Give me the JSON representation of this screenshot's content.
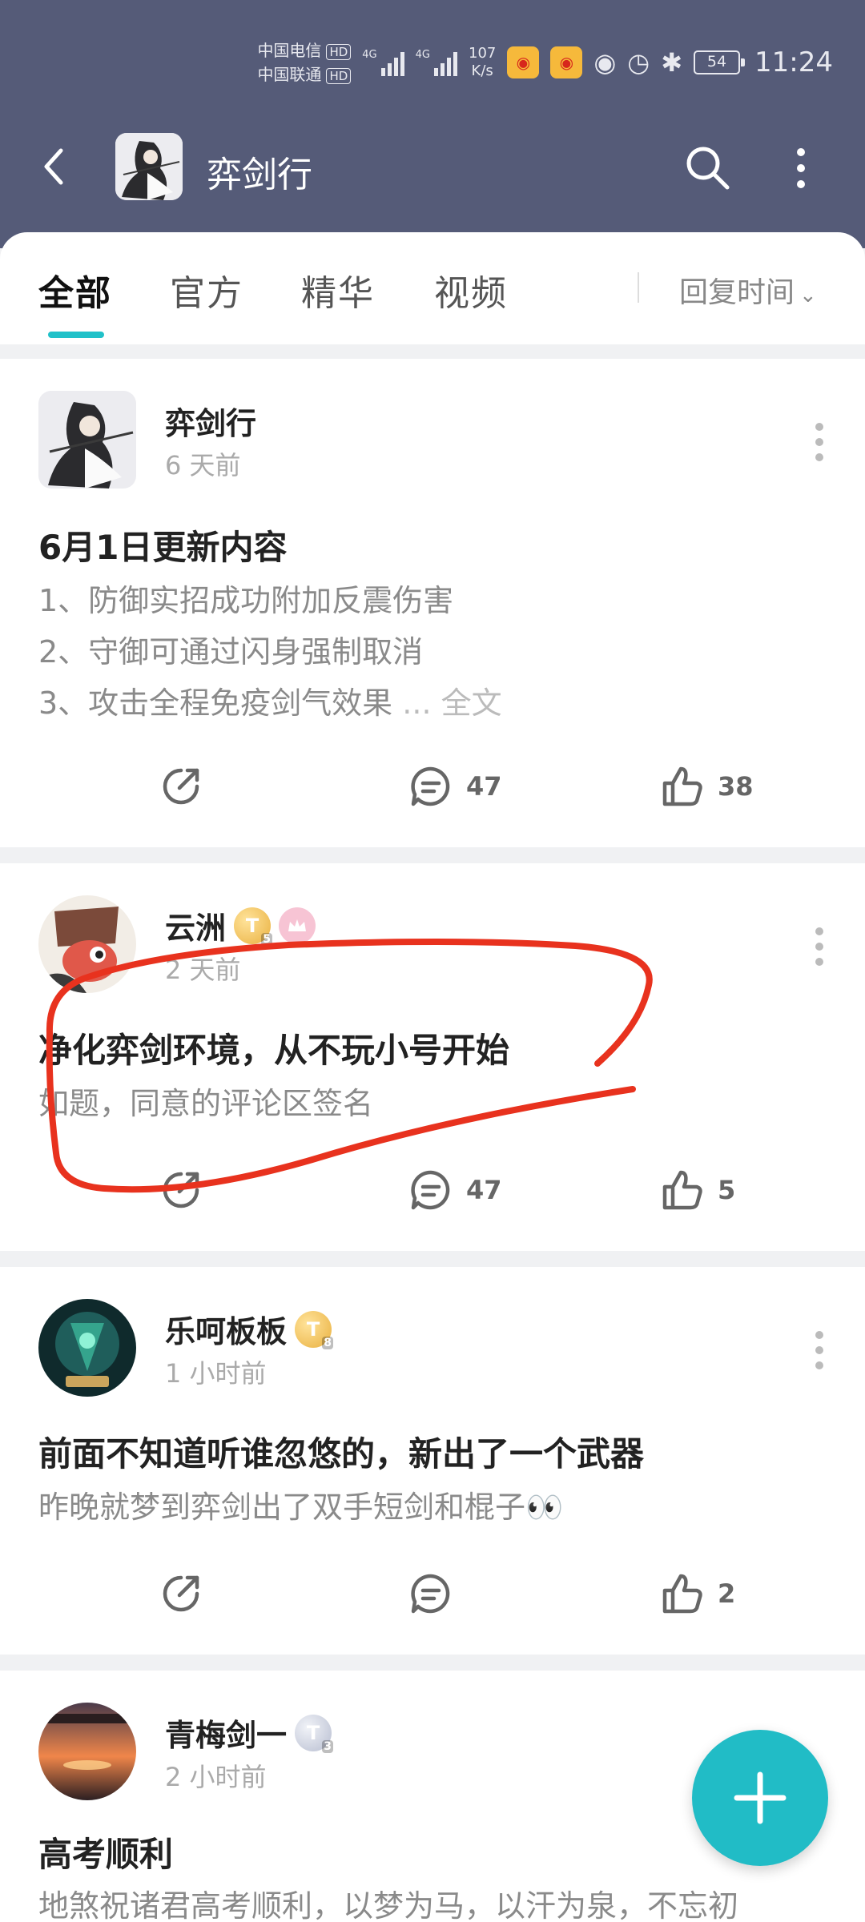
{
  "status_bar": {
    "carrier_1": "中国电信",
    "carrier_2": "中国联通",
    "hd_label": "HD",
    "network_1": "4G",
    "network_2": "4G",
    "speed_value": "107",
    "speed_unit": "K/s",
    "battery": "54",
    "time": "11:24"
  },
  "nav": {
    "title": "弈剑行"
  },
  "tabs": [
    {
      "label": "全部",
      "active": true
    },
    {
      "label": "官方",
      "active": false
    },
    {
      "label": "精华",
      "active": false
    },
    {
      "label": "视频",
      "active": false
    }
  ],
  "sort": {
    "label": "回复时间"
  },
  "posts": [
    {
      "author": "弈剑行",
      "time": "6 天前",
      "title": "6月1日更新内容",
      "body_lines": [
        "1、防御实招成功附加反震伤害",
        "2、守御可通过闪身强制取消",
        "3、攻击全程免疫剑气效果"
      ],
      "ellipsis": "...",
      "full_text_label": "全文",
      "comments": "47",
      "likes": "38"
    },
    {
      "author": "云洲",
      "badge_level": "5",
      "time": "2 天前",
      "title": "净化弈剑环境，从不玩小号开始",
      "body_lines": [
        "如题，同意的评论区签名"
      ],
      "comments": "47",
      "likes": "5"
    },
    {
      "author": "乐呵板板",
      "badge_level": "8",
      "time": "1 小时前",
      "title": "前面不知道听谁忽悠的，新出了一个武器",
      "body_lines": [
        "昨晚就梦到弈剑出了双手短剑和棍子👀"
      ],
      "comments": "",
      "likes": "2"
    },
    {
      "author": "青梅剑一",
      "badge_level": "3",
      "time": "2 小时前",
      "title": "高考顺利",
      "body_lines": [
        "地煞祝诸君高考顺利，以梦为马，以汗为泉，不忘初"
      ],
      "comments": "",
      "likes": ""
    }
  ],
  "badge_letter": "T",
  "colors": {
    "header_bg": "#555b78",
    "accent_teal": "#21c1c9",
    "annotation_red": "#e8321e"
  }
}
